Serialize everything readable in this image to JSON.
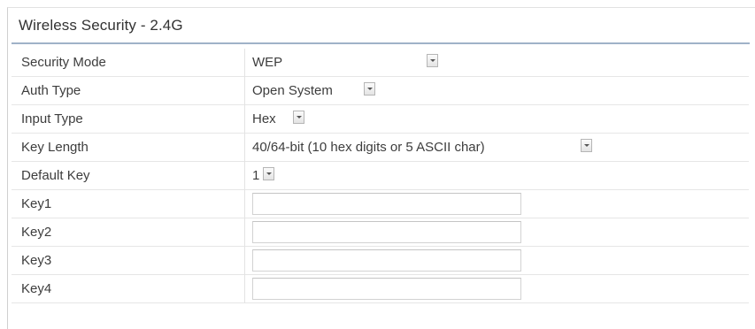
{
  "panel": {
    "title": "Wireless Security - 2.4G"
  },
  "rows": {
    "security_mode": {
      "label": "Security Mode",
      "value": "WEP"
    },
    "auth_type": {
      "label": "Auth Type",
      "value": "Open System"
    },
    "input_type": {
      "label": "Input Type",
      "value": "Hex"
    },
    "key_length": {
      "label": "Key Length",
      "value": "40/64-bit (10 hex digits or 5 ASCII char)"
    },
    "default_key": {
      "label": "Default Key",
      "value": "1"
    },
    "key1": {
      "label": "Key1",
      "value": ""
    },
    "key2": {
      "label": "Key2",
      "value": ""
    },
    "key3": {
      "label": "Key3",
      "value": ""
    },
    "key4": {
      "label": "Key4",
      "value": ""
    }
  },
  "icons": {
    "dropdown": "chevron-down-icon"
  },
  "colors": {
    "title_rule": "#9fb2c8",
    "text": "#3d3d3d",
    "border": "#d2d2d2"
  }
}
